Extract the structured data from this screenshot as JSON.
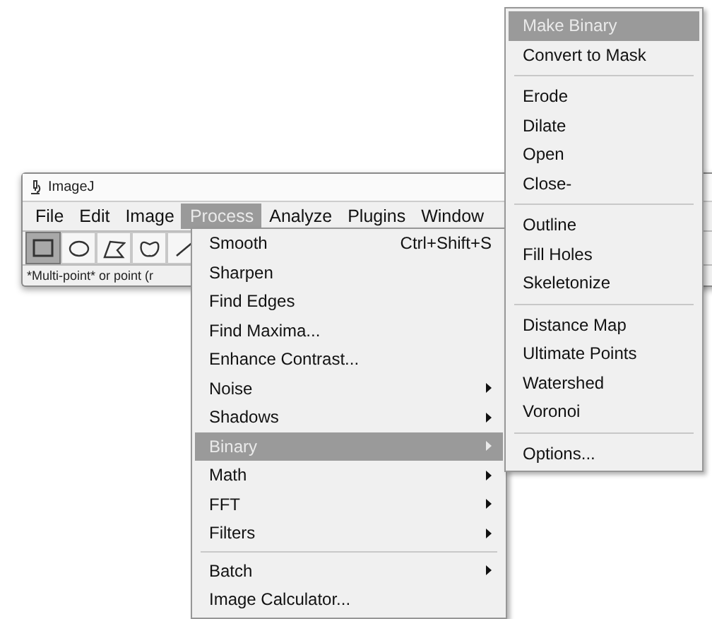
{
  "window": {
    "title": "ImageJ"
  },
  "menubar": [
    {
      "label": "File",
      "selected": false
    },
    {
      "label": "Edit",
      "selected": false
    },
    {
      "label": "Image",
      "selected": false
    },
    {
      "label": "Process",
      "selected": true
    },
    {
      "label": "Analyze",
      "selected": false
    },
    {
      "label": "Plugins",
      "selected": false
    },
    {
      "label": "Window",
      "selected": false
    }
  ],
  "tools": [
    {
      "kind": "rectangle",
      "selected": true
    },
    {
      "kind": "oval",
      "selected": false
    },
    {
      "kind": "polygon",
      "selected": false
    },
    {
      "kind": "freehand",
      "selected": false
    },
    {
      "kind": "line",
      "selected": false
    }
  ],
  "status_bar": "*Multi-point* or point (r",
  "process_menu": [
    {
      "kind": "item",
      "label": "Smooth",
      "shortcut": "Ctrl+Shift+S",
      "submenu": false,
      "selected": false
    },
    {
      "kind": "item",
      "label": "Sharpen",
      "submenu": false,
      "selected": false
    },
    {
      "kind": "item",
      "label": "Find Edges",
      "submenu": false,
      "selected": false
    },
    {
      "kind": "item",
      "label": "Find Maxima...",
      "submenu": false,
      "selected": false
    },
    {
      "kind": "item",
      "label": "Enhance Contrast...",
      "submenu": false,
      "selected": false
    },
    {
      "kind": "item",
      "label": "Noise",
      "submenu": true,
      "selected": false
    },
    {
      "kind": "item",
      "label": "Shadows",
      "submenu": true,
      "selected": false
    },
    {
      "kind": "item",
      "label": "Binary",
      "submenu": true,
      "selected": true
    },
    {
      "kind": "item",
      "label": "Math",
      "submenu": true,
      "selected": false
    },
    {
      "kind": "item",
      "label": "FFT",
      "submenu": true,
      "selected": false
    },
    {
      "kind": "item",
      "label": "Filters",
      "submenu": true,
      "selected": false
    },
    {
      "kind": "separator"
    },
    {
      "kind": "item",
      "label": "Batch",
      "submenu": true,
      "selected": false
    },
    {
      "kind": "item",
      "label": "Image Calculator...",
      "submenu": false,
      "selected": false
    }
  ],
  "binary_submenu": [
    {
      "kind": "item",
      "label": "Make Binary",
      "selected": true
    },
    {
      "kind": "item",
      "label": "Convert to Mask",
      "selected": false
    },
    {
      "kind": "separator"
    },
    {
      "kind": "item",
      "label": "Erode",
      "selected": false
    },
    {
      "kind": "item",
      "label": "Dilate",
      "selected": false
    },
    {
      "kind": "item",
      "label": "Open",
      "selected": false
    },
    {
      "kind": "item",
      "label": "Close-",
      "selected": false
    },
    {
      "kind": "separator"
    },
    {
      "kind": "item",
      "label": "Outline",
      "selected": false
    },
    {
      "kind": "item",
      "label": "Fill Holes",
      "selected": false
    },
    {
      "kind": "item",
      "label": "Skeletonize",
      "selected": false
    },
    {
      "kind": "separator"
    },
    {
      "kind": "item",
      "label": "Distance Map",
      "selected": false
    },
    {
      "kind": "item",
      "label": "Ultimate Points",
      "selected": false
    },
    {
      "kind": "item",
      "label": "Watershed",
      "selected": false
    },
    {
      "kind": "item",
      "label": "Voronoi",
      "selected": false
    },
    {
      "kind": "separator"
    },
    {
      "kind": "item",
      "label": "Options...",
      "selected": false
    }
  ]
}
